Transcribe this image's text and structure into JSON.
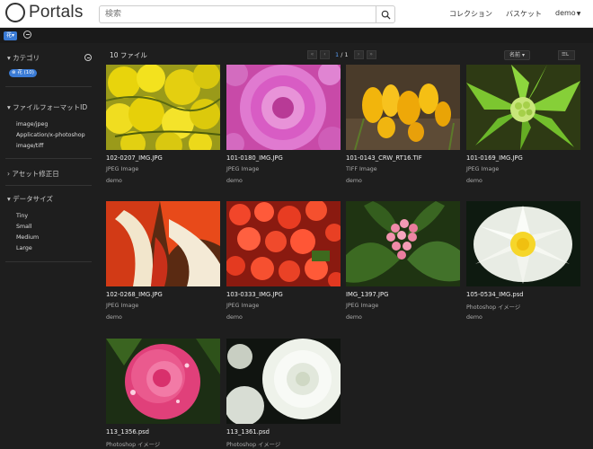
{
  "header": {
    "logo_text": "Portals",
    "search_placeholder": "検索",
    "nav_collection": "コレクション",
    "nav_basket": "バスケット",
    "nav_user": "demo"
  },
  "strip": {
    "filter_chip": "花"
  },
  "sidebar": {
    "category_heading": "カテゴリ",
    "category_tag": "花 (10)",
    "format_heading": "ファイルフォーマットID",
    "formats": [
      "image/jpeg",
      "Application/x-photoshop",
      "image/tiff"
    ],
    "modified_heading": "アセット修正日",
    "size_heading": "データサイズ",
    "sizes": [
      "Tiny",
      "Small",
      "Medium",
      "Large"
    ]
  },
  "main": {
    "file_count": "10 ファイル",
    "page_current": "1",
    "page_total": "/ 1",
    "sort_label": "名前",
    "view_label": "L",
    "files": [
      {
        "name": "102-0207_IMG.JPG",
        "type": "JPEG Image",
        "owner": "demo"
      },
      {
        "name": "101-0180_IMG.JPG",
        "type": "JPEG Image",
        "owner": "demo"
      },
      {
        "name": "101-0143_CRW_RT16.TIF",
        "type": "TIFF Image",
        "owner": "demo"
      },
      {
        "name": "101-0169_IMG.JPG",
        "type": "JPEG Image",
        "owner": "demo"
      },
      {
        "name": "102-0268_IMG.JPG",
        "type": "JPEG Image",
        "owner": "demo"
      },
      {
        "name": "103-0333_IMG.JPG",
        "type": "JPEG Image",
        "owner": "demo"
      },
      {
        "name": "IMG_1397.JPG",
        "type": "JPEG Image",
        "owner": "demo"
      },
      {
        "name": "105-0534_IMG.psd",
        "type": "Photoshop イメージ",
        "owner": "demo"
      },
      {
        "name": "113_1356.psd",
        "type": "Photoshop イメージ",
        "owner": ""
      },
      {
        "name": "113_1361.psd",
        "type": "Photoshop イメージ",
        "owner": ""
      }
    ]
  }
}
